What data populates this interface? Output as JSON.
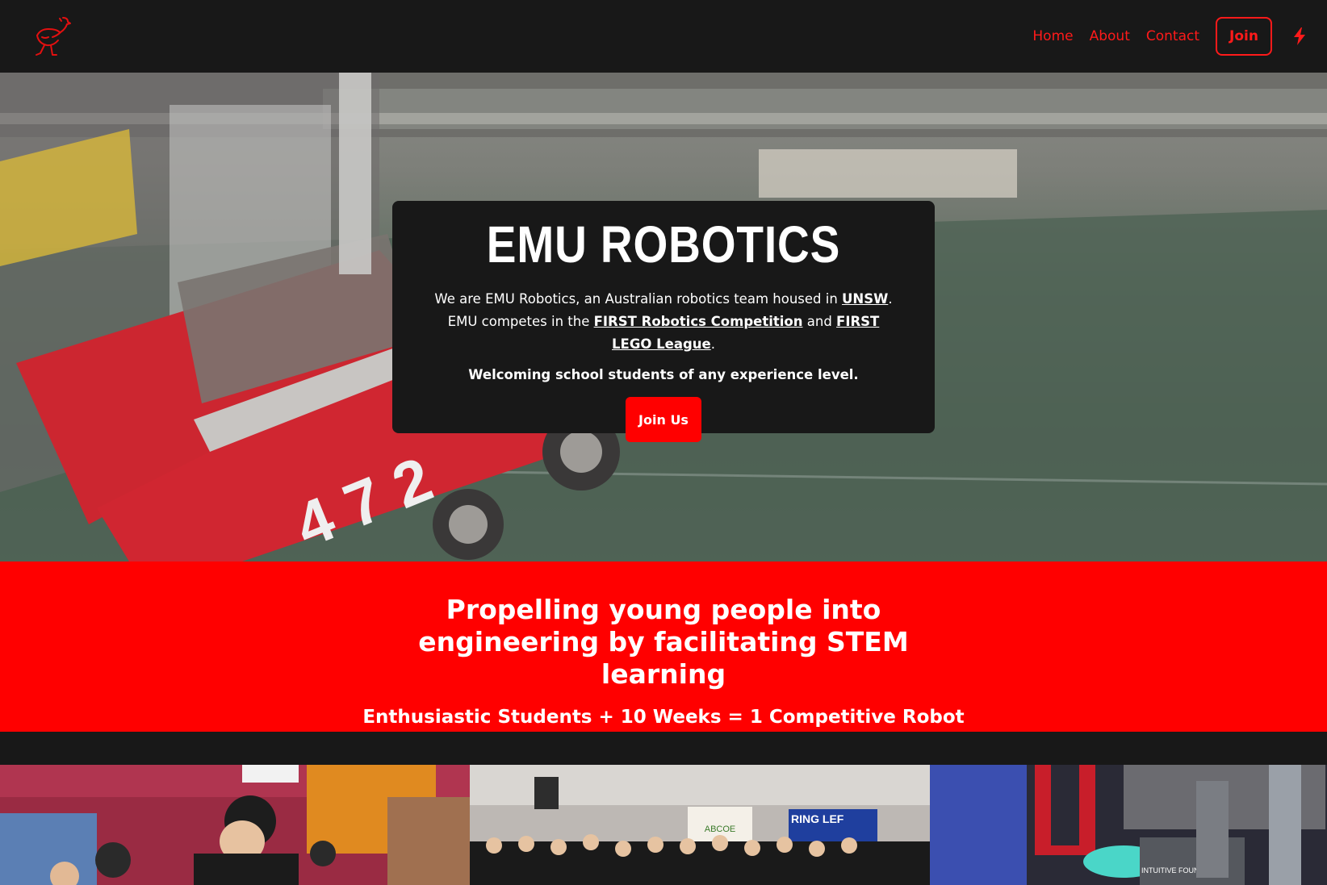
{
  "header": {
    "logo_icon": "emu-logo-icon",
    "nav": [
      {
        "label": "Home"
      },
      {
        "label": "About"
      },
      {
        "label": "Contact"
      }
    ],
    "join_label": "Join",
    "theme_icon": "lightning-bolt-icon"
  },
  "hero": {
    "title": "EMU ROBOTICS",
    "text_pre": "We are EMU Robotics, an Australian robotics team housed in ",
    "link_unsw": "UNSW",
    "text_mid1": ". EMU competes in the ",
    "link_frc": "FIRST Robotics Competition",
    "text_mid2": " and ",
    "link_fll": "FIRST LEGO League",
    "text_end": ".",
    "welcome": "Welcoming school students of any experience level.",
    "cta_label": "Join Us",
    "robot_number": "4 7 2"
  },
  "band": {
    "title": "Propelling young people into engineering by facilitating STEM learning",
    "subtitle": "Enthusiastic Students + 10 Weeks = 1 Competitive Robot"
  },
  "photos": {
    "sign_1": "ABCOE",
    "sign_2": "RING LEF",
    "sign_3": "INTUITIVE FOUNDATION"
  },
  "colors": {
    "accent": "#ff0000",
    "dark": "#181818"
  }
}
